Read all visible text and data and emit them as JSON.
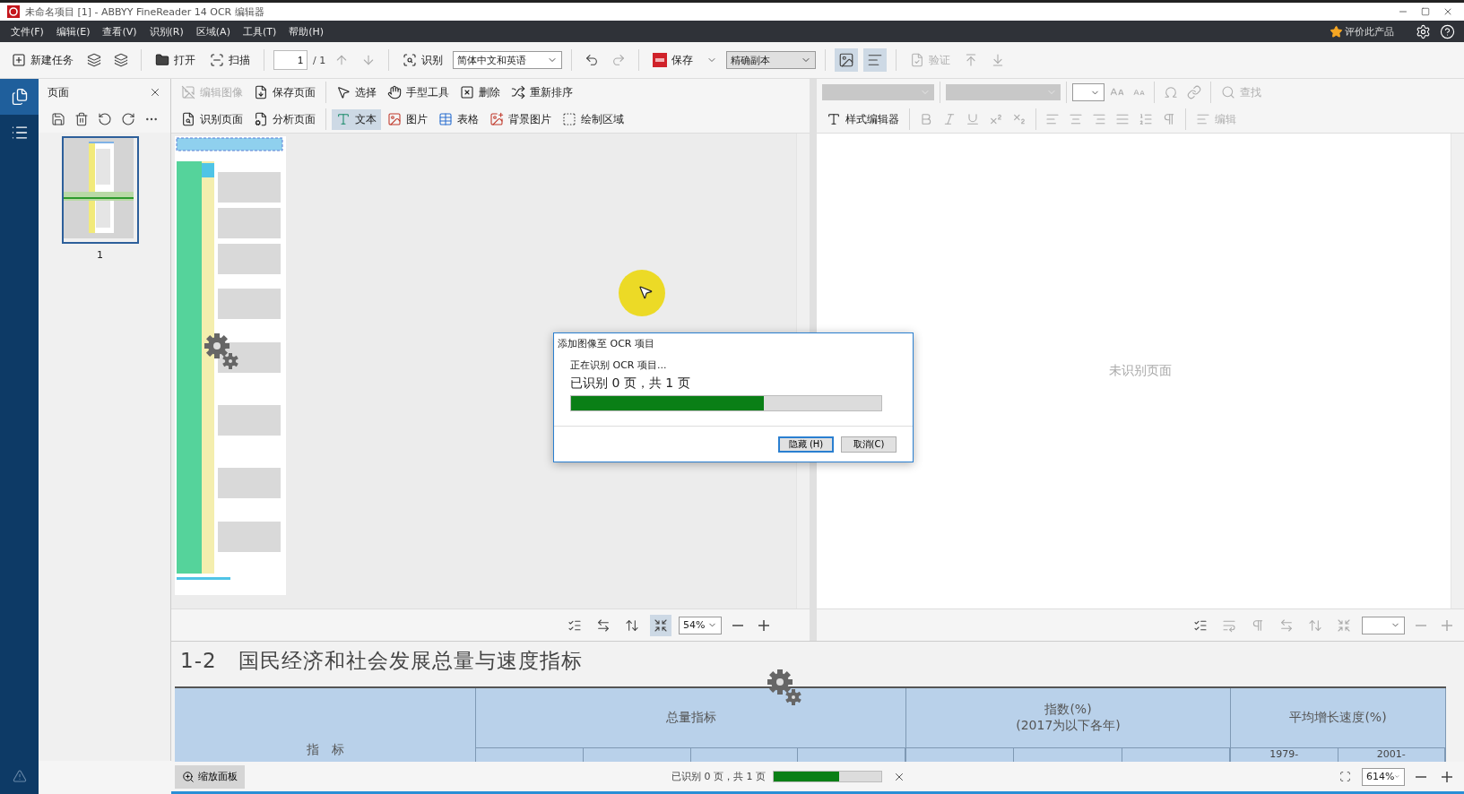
{
  "window": {
    "title": "未命名项目 [1] - ABBYY FineReader 14 OCR 编辑器"
  },
  "menu": [
    "文件(F)",
    "编辑(E)",
    "查看(V)",
    "识别(R)",
    "区域(A)",
    "工具(T)",
    "帮助(H)"
  ],
  "rate_product": "评价此产品",
  "toolbar": {
    "new_task": "新建任务",
    "open": "打开",
    "scan": "扫描",
    "page_number": "1",
    "page_count": "/ 1",
    "recognize": "识别",
    "language": "简体中文和英语",
    "save": "保存",
    "output_mode": "精确副本",
    "view_modes": [
      {
        "selected": true
      },
      {
        "selected": true
      }
    ],
    "verify": {
      "label": "验证",
      "disabled": true
    }
  },
  "pages_panel": {
    "title": "页面",
    "pages": [
      {
        "label": "1",
        "selected": true
      }
    ]
  },
  "image_toolbar": {
    "page_actions": [
      {
        "label": "编辑图像",
        "disabled": true
      },
      {
        "label": "保存页面",
        "disabled": false
      },
      {
        "label": "识别页面",
        "disabled": false
      },
      {
        "label": "分析页面",
        "disabled": false
      }
    ],
    "actions": [
      "选择",
      "手型工具",
      "删除",
      "重新排序"
    ],
    "area_tools": [
      {
        "label": "文本",
        "selected": true
      },
      {
        "label": "图片",
        "selected": false
      },
      {
        "label": "表格",
        "selected": false
      },
      {
        "label": "背景图片",
        "selected": false
      },
      {
        "label": "绘制区域",
        "selected": false
      }
    ]
  },
  "text_toolbar": {
    "style_editor": "样式编辑器",
    "find": {
      "label": "查找",
      "disabled": true
    },
    "edit": {
      "label": "编辑",
      "disabled": true
    }
  },
  "text_pane": {
    "message": "未识别页面"
  },
  "image_zoom": {
    "value": "54%"
  },
  "zoom_panel": {
    "heading": "1-2　国民经济和社会发展总量与速度指标",
    "table": {
      "columns": [
        {
          "label": "指　标"
        },
        {
          "label": "总量指标"
        },
        {
          "label": "指数(%)",
          "note": "(2017为以下各年)"
        },
        {
          "label": "平均增长速度(%)"
        }
      ],
      "subheaders": [
        "1979-",
        "2001-"
      ]
    }
  },
  "status_bar": {
    "zoom_panel_button": "缩放面板",
    "progress_text": "已识别 0 页，共 1 页",
    "level": 0.61,
    "zoom": "614%"
  },
  "dialog": {
    "title": "添加图像至 OCR 项目",
    "status": "正在识别 OCR 项目...",
    "progress_text": "已识别 0 页，共 1 页",
    "level": 0.62,
    "buttons": [
      {
        "label": "隐藏 (H)",
        "default": true
      },
      {
        "label": "取消(C)",
        "default": false
      }
    ]
  }
}
